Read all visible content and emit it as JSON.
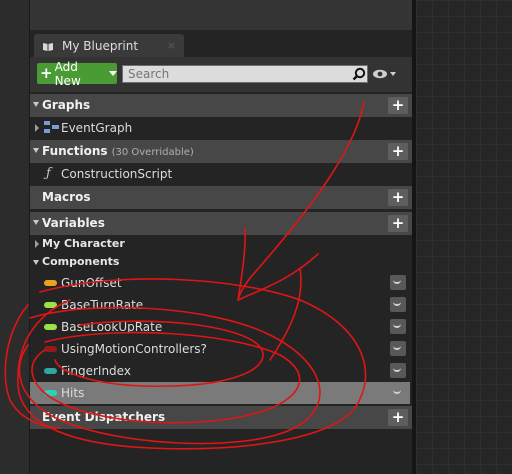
{
  "tab": {
    "title": "My Blueprint",
    "close": "×"
  },
  "toolbar": {
    "add_new_label": "Add New",
    "search_placeholder": "Search"
  },
  "sections": {
    "graphs": {
      "title": "Graphs",
      "items": [
        {
          "label": "EventGraph",
          "icon": "graph-icon"
        }
      ]
    },
    "functions": {
      "title": "Functions",
      "subtitle": "(30 Overridable)",
      "items": [
        {
          "label": "ConstructionScript",
          "icon": "function-icon"
        }
      ]
    },
    "macros": {
      "title": "Macros"
    },
    "variables": {
      "title": "Variables",
      "categories": [
        "My Character",
        "Components"
      ],
      "items": [
        {
          "label": "GunOffset",
          "color": "#e8a41c"
        },
        {
          "label": "BaseTurnRate",
          "color": "#9be24a"
        },
        {
          "label": "BaseLookUpRate",
          "color": "#9be24a"
        },
        {
          "label": "UsingMotionControllers?",
          "color": "#951a1a"
        },
        {
          "label": "FingerIndex",
          "color": "#2fa6a0"
        },
        {
          "label": "Hits",
          "color": "#2fd0b8"
        }
      ]
    },
    "event_dispatchers": {
      "title": "Event Dispatchers"
    }
  },
  "colors": {
    "add_new_bg": "#4a9b33",
    "annotation_stroke": "#e01515",
    "selected_row_bg": "#7a7a7a"
  }
}
